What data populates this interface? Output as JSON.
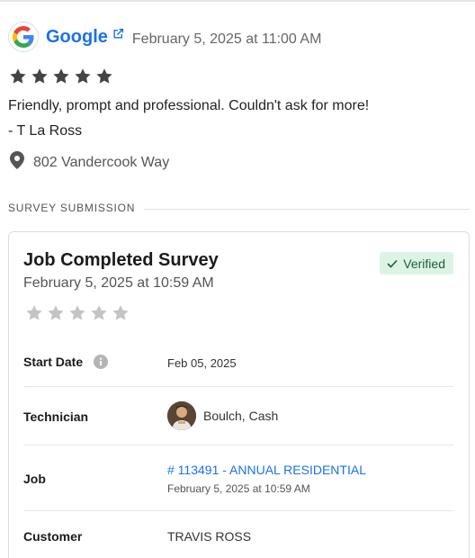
{
  "review": {
    "source": "Google",
    "date": "February 5, 2025 at 11:00 AM",
    "rating": 5,
    "text": "Friendly, prompt and professional. Couldn't ask for more!",
    "author": "- T La Ross",
    "address": "802 Vandercook Way"
  },
  "section_label": "SURVEY SUBMISSION",
  "survey": {
    "title": "Job Completed Survey",
    "date": "February 5, 2025 at 10:59 AM",
    "badge": "Verified",
    "rating": 0,
    "start_date_label": "Start Date",
    "start_date_value": "Feb 05, 2025",
    "technician_label": "Technician",
    "technician_name": "Boulch, Cash",
    "job_label": "Job",
    "job_link": "# 113491 - ANNUAL RESIDENTIAL",
    "job_date": "February 5, 2025 at 10:59 AM",
    "customer_label": "Customer",
    "customer_name": "TRAVIS ROSS"
  },
  "colors": {
    "link": "#1a73e8",
    "star_filled": "#444444",
    "star_empty": "#c4c4c4",
    "verified_bg": "#dcf4e4",
    "verified_text": "#1f5c37"
  },
  "icons": {
    "source_logo": "google-g-icon",
    "external_link": "external-link-icon",
    "location": "map-pin-icon",
    "info": "info-circle-icon",
    "verified": "checkmark-icon",
    "star": "star-icon"
  }
}
